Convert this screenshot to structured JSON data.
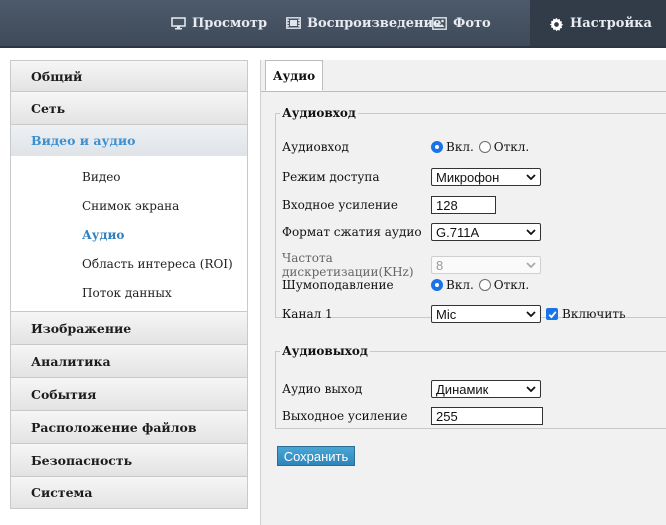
{
  "topnav": {
    "items": [
      {
        "label": "Просмотр",
        "icon": "monitor-icon"
      },
      {
        "label": "Воспроизведение",
        "icon": "film-icon"
      },
      {
        "label": "Фото",
        "icon": "photo-icon"
      },
      {
        "label": "Настройка",
        "icon": "gear-icon",
        "active": true
      }
    ]
  },
  "sidebar": {
    "items": [
      {
        "label": "Общий"
      },
      {
        "label": "Сеть"
      },
      {
        "label": "Видео и аудио",
        "open": true
      },
      {
        "label": "Изображение"
      },
      {
        "label": "Аналитика"
      },
      {
        "label": "События"
      },
      {
        "label": "Расположение файлов"
      },
      {
        "label": "Безопасность"
      },
      {
        "label": "Система"
      }
    ],
    "submenu": [
      {
        "label": "Видео"
      },
      {
        "label": "Снимок экрана"
      },
      {
        "label": "Аудио",
        "active": true
      },
      {
        "label": "Область интереса (ROI)"
      },
      {
        "label": "Поток данных"
      }
    ]
  },
  "main": {
    "tab": "Аудио",
    "audio_in": {
      "legend": "Аудиовход",
      "audio_in_label": "Аудиовход",
      "radio_on": "Вкл.",
      "radio_off": "Откл.",
      "audio_in_value": "on",
      "access_mode_label": "Режим доступа",
      "access_mode_value": "Микрофон",
      "input_gain_label": "Входное усиление",
      "input_gain_value": "128",
      "compression_label": "Формат сжатия аудио",
      "compression_value": "G.711A",
      "sample_rate_label": "Частота дискретизации(KHz)",
      "sample_rate_value": "8",
      "noise_label": "Шумоподавление",
      "noise_value": "on",
      "channel_label": "Канал 1",
      "channel_value": "Mic",
      "channel_enable_label": "Включить",
      "channel_enabled": true
    },
    "audio_out": {
      "legend": "Аудиовыход",
      "audio_out_label": "Аудио выход",
      "audio_out_value": "Динамик",
      "output_gain_label": "Выходное усиление",
      "output_gain_value": "255"
    },
    "save_label": "Сохранить"
  },
  "colors": {
    "topbar": "#44505f",
    "accent": "#1a73e8",
    "sidebar_open": "#3c8fd0",
    "save_button": "#3399cc"
  }
}
